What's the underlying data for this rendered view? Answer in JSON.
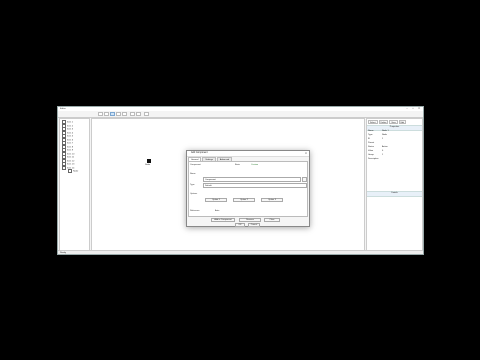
{
  "window": {
    "title": "Editor",
    "min": "–",
    "max": "□",
    "close": "✕"
  },
  "toolbar": {
    "buttons": [
      "back",
      "forward",
      "select",
      "connect",
      "text",
      "box",
      "line",
      "edit"
    ]
  },
  "tree": {
    "items": [
      "Item 1",
      "Item 2",
      "Item 3",
      "Item 4",
      "Item 5",
      "Item 6",
      "Item 7",
      "Item 8",
      "Item 9",
      "Item 10",
      "Item 11",
      "Item 12",
      "Item 13",
      "Item 14"
    ],
    "child": "Node"
  },
  "canvas": {
    "node_label": "Node"
  },
  "props": {
    "buttons": [
      "Select",
      "Delete",
      "View",
      "Edit"
    ],
    "header": "Properties",
    "rows": [
      {
        "k": "Name",
        "v": "Node 1"
      },
      {
        "k": "Type",
        "v": "Node"
      },
      {
        "k": "ID",
        "v": "1"
      },
      {
        "k": "Parent",
        "v": ""
      },
      {
        "k": "Status",
        "v": "Active"
      },
      {
        "k": "Value",
        "v": "0"
      },
      {
        "k": "Group",
        "v": "1"
      },
      {
        "k": "Description",
        "v": ""
      }
    ],
    "footer": "Details"
  },
  "status": {
    "text": "Ready"
  },
  "dialog": {
    "title": "Add Component",
    "close": "✕",
    "tabs": [
      "General",
      "Settings",
      "Advanced"
    ],
    "radio_a": "Basic",
    "radio_b": "Custom",
    "label_component": "Component",
    "label_name": "Name",
    "label_type": "Type",
    "label_options": "Options",
    "name_value": "Component",
    "type_value": "Default",
    "opt_buttons": [
      "Option 1",
      "Option 2",
      "Option 3"
    ],
    "mid_label": "Reference",
    "mid_value": "Auto",
    "foot_buttons": [
      "Add to Component",
      "Remove",
      "Clear"
    ],
    "ok": "OK",
    "cancel": "Cancel"
  }
}
